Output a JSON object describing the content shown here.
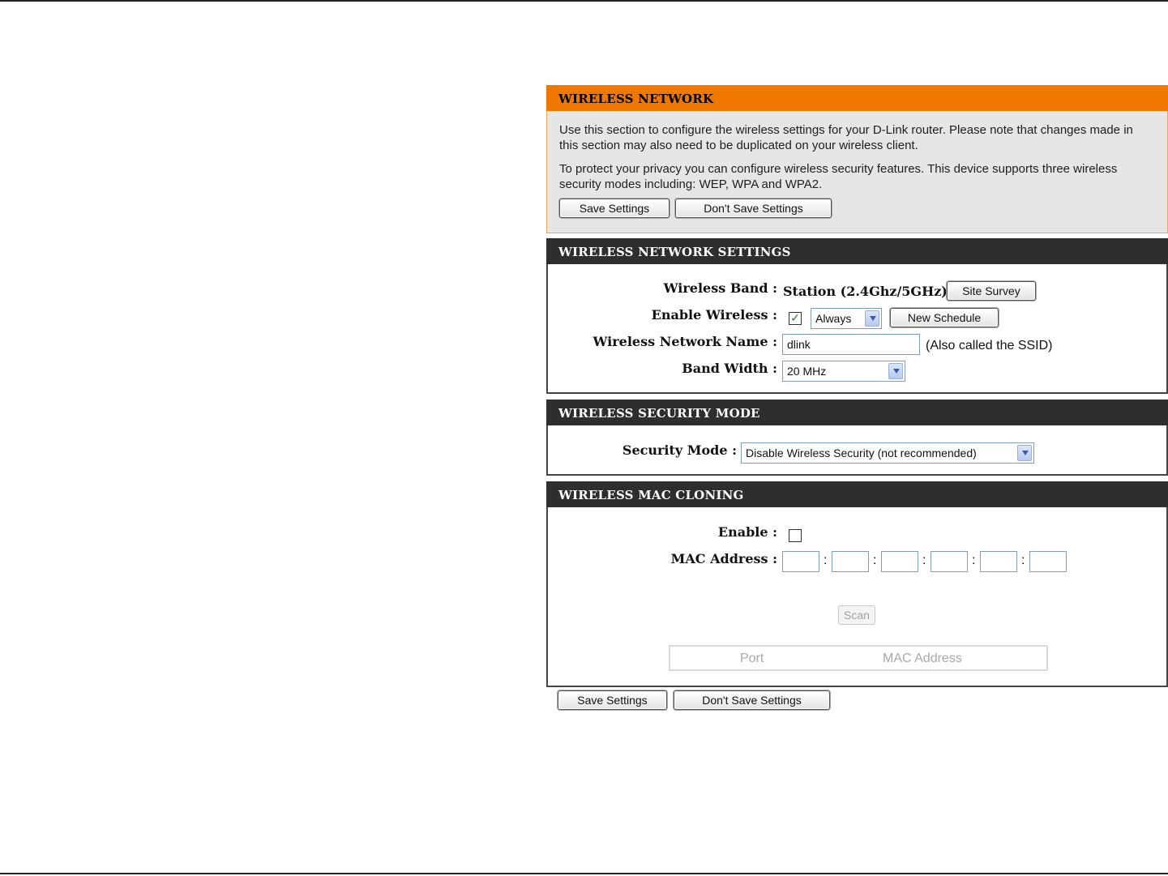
{
  "wireless_network": {
    "title": "WIRELESS NETWORK",
    "paragraph1": "Use this section to configure the wireless settings for your D-Link router. Please note that changes made in this section may also need to be duplicated on your wireless client.",
    "paragraph2": "To protect your privacy you can configure wireless security features. This device supports three wireless security modes including: WEP, WPA and WPA2.",
    "save_label": "Save Settings",
    "dont_save_label": "Don't Save Settings"
  },
  "settings": {
    "title": "WIRELESS NETWORK SETTINGS",
    "band_label": "Wireless Band :",
    "band_value": "Station (2.4Ghz/5GHz)",
    "site_survey_label": "Site Survey",
    "enable_label": "Enable Wireless :",
    "enable_checked": true,
    "schedule_value": "Always",
    "new_schedule_label": "New Schedule",
    "name_label": "Wireless Network Name :",
    "name_value": "dlink",
    "name_note": "(Also called the SSID)",
    "bandwidth_label": "Band Width :",
    "bandwidth_value": "20 MHz"
  },
  "security": {
    "title": "WIRELESS SECURITY MODE",
    "mode_label": "Security Mode :",
    "mode_value": "Disable Wireless Security (not recommended)"
  },
  "mac_cloning": {
    "title": "WIRELESS MAC CLONING",
    "enable_label": "Enable :",
    "enable_checked": false,
    "mac_label": "MAC Address :",
    "separator": ":",
    "scan_label": "Scan",
    "table_headers": [
      "Port",
      "MAC Address"
    ]
  },
  "footer": {
    "save_label": "Save Settings",
    "dont_save_label": "Don't Save Settings"
  },
  "colors": {
    "header_orange": "#f07800",
    "header_dark": "#2e2e2e",
    "intro_bg": "#e6e6e6"
  }
}
